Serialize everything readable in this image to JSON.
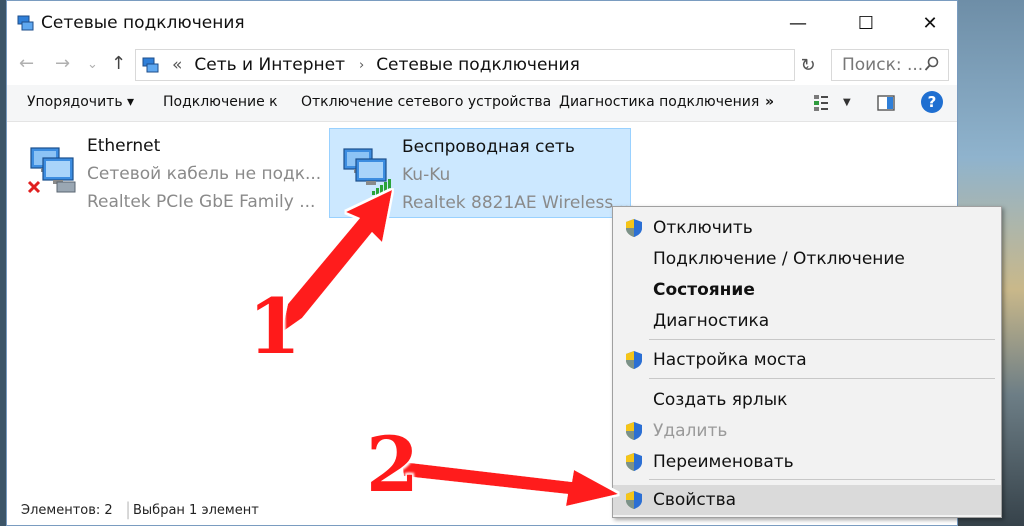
{
  "window": {
    "title": "Сетевые подключения",
    "minimize": "—",
    "maximize": "☐",
    "close": "✕"
  },
  "nav": {
    "back": "←",
    "forward": "→",
    "history": "⌄",
    "up": "↑",
    "breadcrumb_prefix": "«",
    "breadcrumb": [
      "Сеть и Интернет",
      "Сетевые подключения"
    ],
    "separator": "›",
    "dropdown": "⌄",
    "refresh": "↻",
    "search_placeholder": "Поиск: ..."
  },
  "toolbar": {
    "organize": "Упорядочить ▾",
    "connect": "Подключение к",
    "disable_device": "Отключение сетевого устройства",
    "diagnose": "Диагностика подключения",
    "more": "»",
    "help": "?"
  },
  "connections": [
    {
      "name": "Ethernet",
      "status": "Сетевой кабель не подк...",
      "adapter": "Realtek PCIe GbE Family ..."
    },
    {
      "name": "Беспроводная сеть",
      "status": "Ku-Ku",
      "adapter": "Realtek 8821AE Wireless ..."
    }
  ],
  "status_bar": {
    "items_count": "Элементов: 2",
    "selected": "Выбран 1 элемент"
  },
  "context_menu": [
    {
      "label": "Отключить",
      "shield": true
    },
    {
      "label": "Подключение / Отключение",
      "shield": false
    },
    {
      "label": "Состояние",
      "shield": false,
      "bold": true
    },
    {
      "label": "Диагностика",
      "shield": false
    },
    {
      "label": "Настройка моста",
      "shield": true
    },
    {
      "label": "Создать ярлык",
      "shield": false
    },
    {
      "label": "Удалить",
      "shield": true,
      "disabled": true
    },
    {
      "label": "Переименовать",
      "shield": true
    },
    {
      "label": "Свойства",
      "shield": true,
      "highlighted": true
    }
  ],
  "annotations": {
    "step1": "1",
    "step2": "2",
    "arrow_color": "#ff1a1a"
  },
  "colors": {
    "selection": "#cce8ff",
    "help": "#1f6fd1",
    "menu_bg": "#f2f2f2"
  }
}
